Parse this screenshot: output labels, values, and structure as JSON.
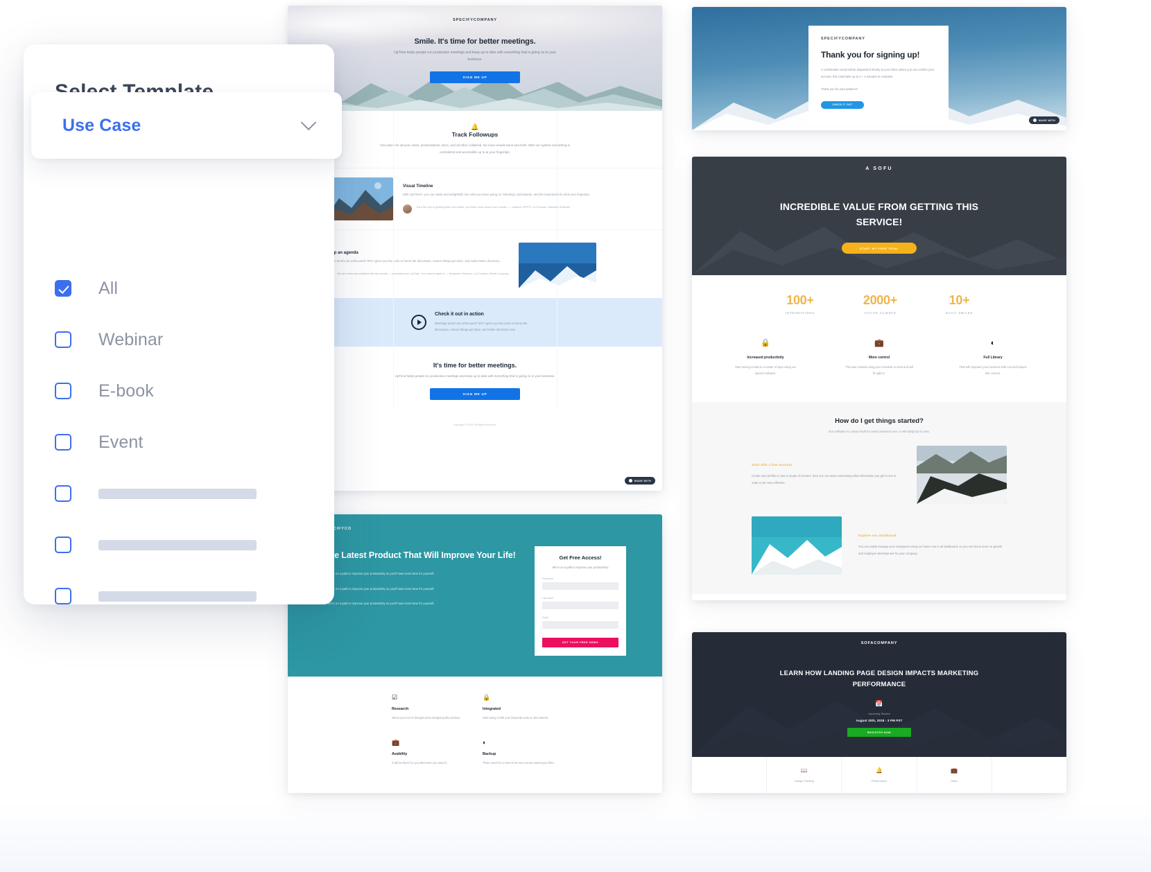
{
  "panel": {
    "title": "Select Template",
    "dropdown": {
      "label": "Use Case",
      "chevron_icon": "chevron-down-icon"
    },
    "options": [
      {
        "label": "All",
        "checked": true,
        "placeholder": false
      },
      {
        "label": "Webinar",
        "checked": false,
        "placeholder": false
      },
      {
        "label": "E-book",
        "checked": false,
        "placeholder": false
      },
      {
        "label": "Event",
        "checked": false,
        "placeholder": false
      },
      {
        "label": "",
        "checked": false,
        "placeholder": true
      },
      {
        "label": "",
        "checked": false,
        "placeholder": true
      },
      {
        "label": "",
        "checked": false,
        "placeholder": true
      }
    ]
  },
  "colors": {
    "accent_blue": "#3d6ef0",
    "cta_blue": "#1273e6",
    "teal": "#2d97a3",
    "pink": "#ec0f5e",
    "amber": "#f6b21b",
    "green": "#19ab21",
    "dark": "#252c38"
  },
  "templates": {
    "meetings": {
      "logo": "SPECIFYCOMPANY",
      "hero_title": "Smile. It's time for better meetings.",
      "hero_sub": "UpTime helps people run productive meetings and keep up to date with everything that is going on in your business.",
      "hero_cta": "SIGN ME UP",
      "feature_icon": "bell-icon",
      "feature_title": "Track Followups",
      "feature_sub": "One place for all your notes, presentations, docs, and all other collateral. No more emails back and forth. With our system everything is centralized and accessible up to at your fingertips.",
      "row1_title": "Visual Timeline",
      "row1_body": "With UpTime®, you can easily and delightfully see what you have going on. Meetings, participants, and the important info all at your fingertips.",
      "row1_quote": "Then life only is getting better and better, you learn more about how it works. — Julianne GIPPS, Co-Founder, Standard Software",
      "row2_title": "Set up an agenda",
      "row2_body": "Meetings tend to be unfocused? WGY gives you the tools to frame the discussion, ensure things get done, and make better decisions.",
      "row2_quote": "We are extremely satisfied with the results — absolutely love UpTime. You cannot regret it. — Benjamin Petersen, Co-Founder, Worth Company",
      "video_title": "Check it out in action",
      "video_body": "Meetings tend to be unfocused? WGY gives you the tools to frame the discussion, ensure things get done, and make decisions now.",
      "footer_title": "It's time for better meetings.",
      "footer_sub": "UpTime helps people run productive meetings and keep up to date with everything that is going on in your business.",
      "footer_cta": "SIGN ME UP",
      "copyright": "Copyright © 2018. All Rights Reserved.",
      "badge": "MADE WITH"
    },
    "thankyou": {
      "logo": "SPECIFYCOMPANY",
      "title": "Thank you for signing up!",
      "body": "A confirmation email will be dispatched shortly to your inbox where you can confirm your account, this could take up to 2 – 3 minutes to complete.",
      "note": "Thank you for your patience!",
      "cta": "CHECK IT OUT",
      "badge": "MADE WITH"
    },
    "sofu": {
      "logo": "A SOFU",
      "headline": "INCREDIBLE VALUE FROM GETTING THIS SERVICE!",
      "cta": "START MY FREE TRIAL",
      "stats": [
        {
          "number": "100+",
          "label": "INTEGRATIONS"
        },
        {
          "number": "2000+",
          "label": "ACTIVE CLIENTS"
        },
        {
          "number": "10+",
          "label": "DAILY SMILES"
        }
      ],
      "features": [
        {
          "icon": "lock-icon",
          "title": "Increased productivity",
          "desc": "Start seeing results in a matter of days using our special software."
        },
        {
          "icon": "briefcase-icon",
          "title": "More control",
          "desc": "This was created using your schedule in mind and will fit right in."
        },
        {
          "icon": "pie-chart-icon",
          "title": "Full Library",
          "desc": "That will empower your business with cool techniques that convert."
        }
      ],
      "started_title": "How do I get things started?",
      "started_sub": "Our software is custom built for every business size. It will adapt by its own.",
      "block1_kicker": "Start with a free account",
      "block1_body": "Create new profiles in just a couple of minutes, then you can start customising what information you get to see in order to be more effective.",
      "block2_kicker": "Explore our dashboard",
      "block2_body": "You can easily manage your employees using our future one in all dashboard, so you can focus more on growth and employee development for your company."
    },
    "specifyco": {
      "logo": "SPECIFYCO",
      "headline": "The Latest Product That Will Improve Your Life!",
      "bullets": [
        "1. We're on a path to improve your productivity so you'll have more time for yourself.",
        "2. We're on a path to improve your productivity so you'll have more time for yourself.",
        "3. We're on a path to improve your productivity so you'll have more time for yourself."
      ],
      "form_title": "Get Free Access!",
      "form_sub": "We're on a path to improve your productivity!",
      "fields": [
        {
          "label": "First name",
          "value": ""
        },
        {
          "label": "Last name",
          "value": ""
        },
        {
          "label": "Email",
          "value": ""
        }
      ],
      "submit": "GET YOUR FREE DEMO",
      "features": [
        {
          "icon": "check-square-icon",
          "title": "Research",
          "desc": "We've put a lot of thought when designing this product."
        },
        {
          "icon": "lock-icon",
          "title": "Integrated",
          "desc": "Start using it with your favourite tools on the internet."
        },
        {
          "icon": "briefcase-icon",
          "title": "Avability",
          "desc": "It will be there for you whenever you need it."
        },
        {
          "icon": "pie-chart-icon",
          "title": "Backup",
          "desc": "There won't be a need to be sure you've saved your files."
        }
      ]
    },
    "webinar": {
      "logo": "SOFACOMPANY",
      "headline": "LEARN HOW LANDING PAGE DESIGN IMPACTS MARKETING PERFORMANCE",
      "calendar_icon": "calendar-icon",
      "upcoming": "Upcoming Session",
      "date": "August 20th, 2018 - 3 PM PST",
      "cta": "REGISTER NOW",
      "footer": [
        {
          "icon": "book-icon",
          "label": "Design Thinking"
        },
        {
          "icon": "bell-icon",
          "label": "Performance"
        },
        {
          "icon": "briefcase-icon",
          "label": "Sales"
        }
      ]
    }
  }
}
